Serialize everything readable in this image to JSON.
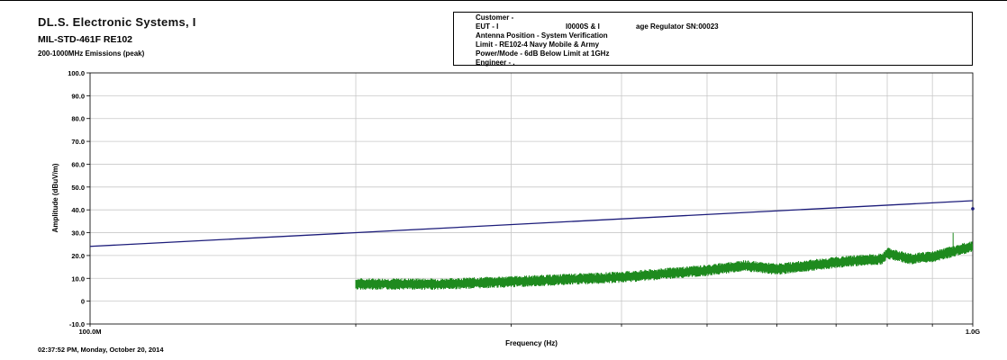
{
  "header": {
    "company": "DL.S. Electronic Systems, I",
    "title": "MIL-STD-461F RE102",
    "subtitle": "200-1000MHz Emissions (peak)"
  },
  "info": {
    "customer": "Customer -",
    "eut_prefix": "EUT - I",
    "eut_mid": "I0000S & I",
    "eut_suffix": "age Regulator SN:00023",
    "antenna": "Antenna Position - System Verification",
    "limit": "Limit - RE102-4 Navy Mobile & Army",
    "power": "Power/Mode - 6dB Below Limit at 1GHz",
    "engineer": "Engineer - ."
  },
  "timestamp": "02:37:52 PM, Monday, October 20, 2014",
  "chart_data": {
    "type": "line",
    "xlabel": "Frequency (Hz)",
    "ylabel": "Amplitude (dBuV/m)",
    "x_scale": "log",
    "xlim": [
      100000000,
      1000000000
    ],
    "ylim": [
      -10,
      100
    ],
    "yticks": [
      "100.0",
      "90.0",
      "80.0",
      "70.0",
      "60.0",
      "50.0",
      "40.0",
      "30.0",
      "20.0",
      "10.0",
      "0",
      "-10.0"
    ],
    "xtick_labels": [
      "100.0M",
      "1.0G"
    ],
    "grid": true,
    "series": [
      {
        "color": "#1c1c7a",
        "x": [
          100000000,
          1000000000
        ],
        "y": [
          24.0,
          44.0
        ]
      },
      {
        "color": "#1e8a1e",
        "x": [
          200000000,
          250000000,
          300000000,
          400000000,
          500000000,
          550000000,
          600000000,
          700000000,
          750000000,
          790000000,
          800000000,
          850000000,
          900000000,
          1000000000
        ],
        "y": [
          7.5,
          7.5,
          8.5,
          10.5,
          13.5,
          15.5,
          14.0,
          17.0,
          18.0,
          18.5,
          21.0,
          18.5,
          19.5,
          24.0
        ]
      }
    ],
    "marker": {
      "x": 1000000000,
      "y": 40.5,
      "color": "#1c1c7a"
    }
  }
}
